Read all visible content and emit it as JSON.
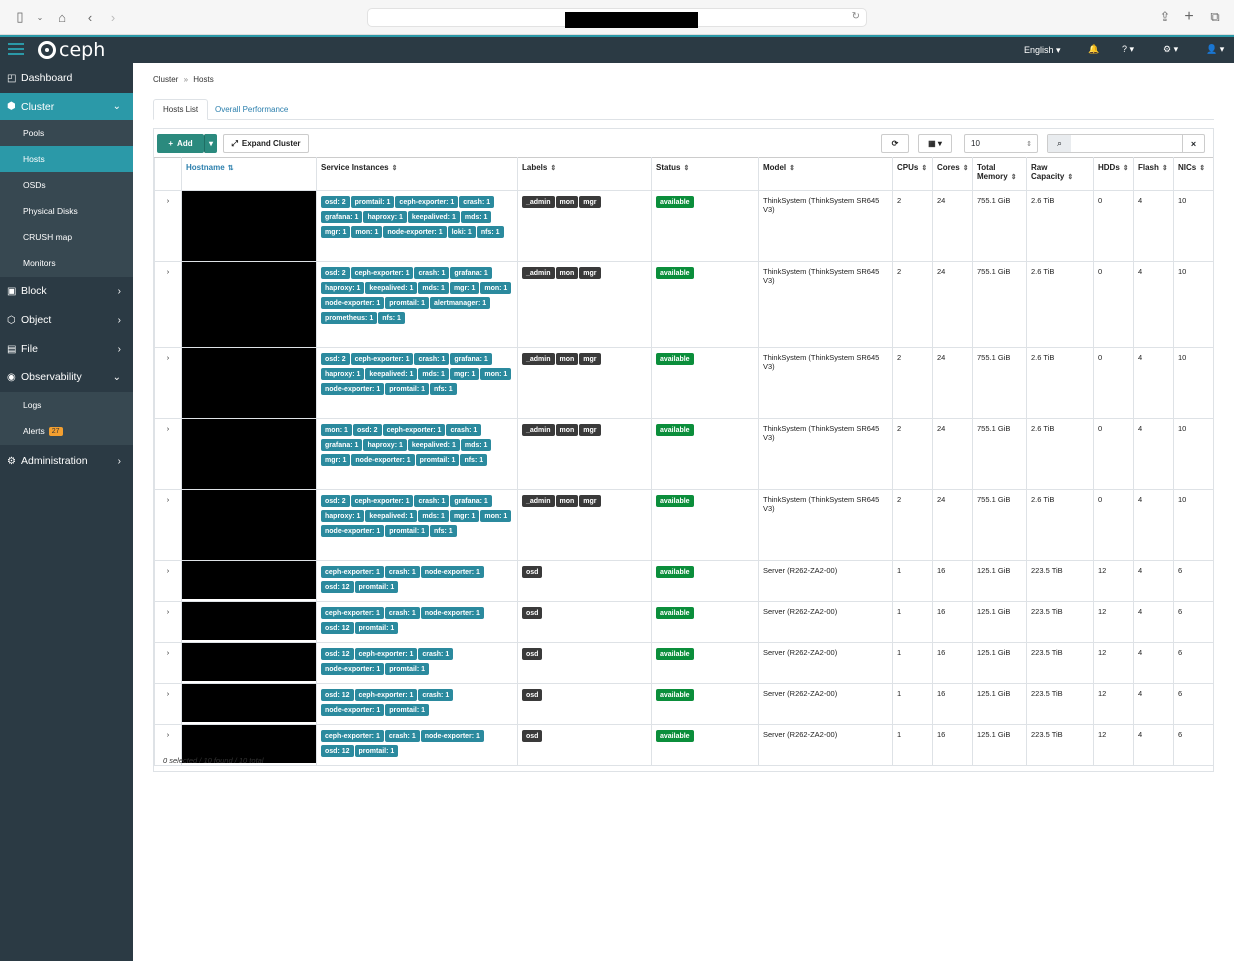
{
  "app": {
    "brand": "ceph"
  },
  "navbar": {
    "language": "English ▾",
    "help": "? ▾",
    "settings": "⚙ ▾",
    "user": "👤 ▾"
  },
  "sidebar": {
    "dashboard": "Dashboard",
    "cluster": "Cluster",
    "cluster_items": [
      "Pools",
      "Hosts",
      "OSDs",
      "Physical Disks",
      "CRUSH map",
      "Monitors"
    ],
    "block": "Block",
    "object": "Object",
    "file": "File",
    "observability": "Observability",
    "observability_items": [
      "Logs",
      "Alerts"
    ],
    "alerts_count": "27",
    "administration": "Administration"
  },
  "breadcrumb": {
    "parent": "Cluster",
    "current": "Hosts"
  },
  "tabs": [
    "Hosts List",
    "Overall Performance"
  ],
  "toolbar": {
    "add": "Add",
    "expand": "Expand Cluster",
    "page_size": "10"
  },
  "table": {
    "columns": [
      "Hostname",
      "Service Instances",
      "Labels",
      "Status",
      "Model",
      "CPUs",
      "Cores",
      "Total Memory",
      "Raw Capacity",
      "HDDs",
      "Flash",
      "NICs"
    ],
    "rows": [
      {
        "services": [
          "osd: 2",
          "promtail: 1",
          "ceph-exporter: 1",
          "crash: 1",
          "grafana: 1",
          "haproxy: 1",
          "keepalived: 1",
          "mds: 1",
          "mgr: 1",
          "mon: 1",
          "node-exporter: 1",
          "loki: 1",
          "nfs: 1"
        ],
        "labels": [
          "_admin",
          "mon",
          "mgr"
        ],
        "status": "available",
        "model": "ThinkSystem (ThinkSystem SR645 V3)",
        "cpus": "2",
        "cores": "24",
        "memory": "755.1 GiB",
        "raw": "2.6 TiB",
        "hdds": "0",
        "flash": "4",
        "nics": "10"
      },
      {
        "services": [
          "osd: 2",
          "ceph-exporter: 1",
          "crash: 1",
          "grafana: 1",
          "haproxy: 1",
          "keepalived: 1",
          "mds: 1",
          "mgr: 1",
          "mon: 1",
          "node-exporter: 1",
          "promtail: 1",
          "alertmanager: 1",
          "prometheus: 1",
          "nfs: 1"
        ],
        "labels": [
          "_admin",
          "mon",
          "mgr"
        ],
        "status": "available",
        "model": "ThinkSystem (ThinkSystem SR645 V3)",
        "cpus": "2",
        "cores": "24",
        "memory": "755.1 GiB",
        "raw": "2.6 TiB",
        "hdds": "0",
        "flash": "4",
        "nics": "10"
      },
      {
        "services": [
          "osd: 2",
          "ceph-exporter: 1",
          "crash: 1",
          "grafana: 1",
          "haproxy: 1",
          "keepalived: 1",
          "mds: 1",
          "mgr: 1",
          "mon: 1",
          "node-exporter: 1",
          "promtail: 1",
          "nfs: 1"
        ],
        "labels": [
          "_admin",
          "mon",
          "mgr"
        ],
        "status": "available",
        "model": "ThinkSystem (ThinkSystem SR645 V3)",
        "cpus": "2",
        "cores": "24",
        "memory": "755.1 GiB",
        "raw": "2.6 TiB",
        "hdds": "0",
        "flash": "4",
        "nics": "10"
      },
      {
        "services": [
          "mon: 1",
          "osd: 2",
          "ceph-exporter: 1",
          "crash: 1",
          "grafana: 1",
          "haproxy: 1",
          "keepalived: 1",
          "mds: 1",
          "mgr: 1",
          "node-exporter: 1",
          "promtail: 1",
          "nfs: 1"
        ],
        "labels": [
          "_admin",
          "mon",
          "mgr"
        ],
        "status": "available",
        "model": "ThinkSystem (ThinkSystem SR645 V3)",
        "cpus": "2",
        "cores": "24",
        "memory": "755.1 GiB",
        "raw": "2.6 TiB",
        "hdds": "0",
        "flash": "4",
        "nics": "10"
      },
      {
        "services": [
          "osd: 2",
          "ceph-exporter: 1",
          "crash: 1",
          "grafana: 1",
          "haproxy: 1",
          "keepalived: 1",
          "mds: 1",
          "mgr: 1",
          "mon: 1",
          "node-exporter: 1",
          "promtail: 1",
          "nfs: 1"
        ],
        "labels": [
          "_admin",
          "mon",
          "mgr"
        ],
        "status": "available",
        "model": "ThinkSystem (ThinkSystem SR645 V3)",
        "cpus": "2",
        "cores": "24",
        "memory": "755.1 GiB",
        "raw": "2.6 TiB",
        "hdds": "0",
        "flash": "4",
        "nics": "10"
      },
      {
        "services": [
          "ceph-exporter: 1",
          "crash: 1",
          "node-exporter: 1",
          "osd: 12",
          "promtail: 1"
        ],
        "labels": [
          "osd"
        ],
        "status": "available",
        "model": "Server (R262-ZA2-00)",
        "cpus": "1",
        "cores": "16",
        "memory": "125.1 GiB",
        "raw": "223.5 TiB",
        "hdds": "12",
        "flash": "4",
        "nics": "6"
      },
      {
        "services": [
          "ceph-exporter: 1",
          "crash: 1",
          "node-exporter: 1",
          "osd: 12",
          "promtail: 1"
        ],
        "labels": [
          "osd"
        ],
        "status": "available",
        "model": "Server (R262-ZA2-00)",
        "cpus": "1",
        "cores": "16",
        "memory": "125.1 GiB",
        "raw": "223.5 TiB",
        "hdds": "12",
        "flash": "4",
        "nics": "6"
      },
      {
        "services": [
          "osd: 12",
          "ceph-exporter: 1",
          "crash: 1",
          "node-exporter: 1",
          "promtail: 1"
        ],
        "labels": [
          "osd"
        ],
        "status": "available",
        "model": "Server (R262-ZA2-00)",
        "cpus": "1",
        "cores": "16",
        "memory": "125.1 GiB",
        "raw": "223.5 TiB",
        "hdds": "12",
        "flash": "4",
        "nics": "6"
      },
      {
        "services": [
          "osd: 12",
          "ceph-exporter: 1",
          "crash: 1",
          "node-exporter: 1",
          "promtail: 1"
        ],
        "labels": [
          "osd"
        ],
        "status": "available",
        "model": "Server (R262-ZA2-00)",
        "cpus": "1",
        "cores": "16",
        "memory": "125.1 GiB",
        "raw": "223.5 TiB",
        "hdds": "12",
        "flash": "4",
        "nics": "6"
      },
      {
        "services": [
          "ceph-exporter: 1",
          "crash: 1",
          "node-exporter: 1",
          "osd: 12",
          "promtail: 1"
        ],
        "labels": [
          "osd"
        ],
        "status": "available",
        "model": "Server (R262-ZA2-00)",
        "cpus": "1",
        "cores": "16",
        "memory": "125.1 GiB",
        "raw": "223.5 TiB",
        "hdds": "12",
        "flash": "4",
        "nics": "6"
      }
    ]
  },
  "footer": "0 selected / 10 found / 10 total",
  "colors": {
    "accent": "#2b99a8",
    "navbar": "#2b3a44",
    "tag": "#2b8a9e",
    "status": "#0b8e3b"
  }
}
